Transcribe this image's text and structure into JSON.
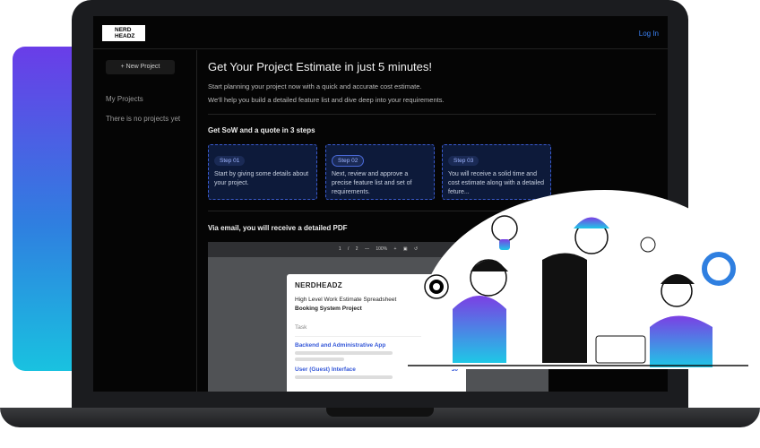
{
  "header": {
    "logo": "NERD HEADZ",
    "login": "Log In"
  },
  "sidebar": {
    "new_project": "+ New Project",
    "my_projects": "My Projects",
    "empty": "There is no projects yet"
  },
  "main": {
    "title": "Get Your Project Estimate in just 5 minutes!",
    "intro1": "Start planning your project now with a quick and accurate cost estimate.",
    "intro2": "We'll help you build a detailed feature list and dive deep into your requirements.",
    "steps_heading": "Get SoW and a quote in 3 steps",
    "steps": [
      {
        "label": "Step 01",
        "text": "Start by giving some details about your project."
      },
      {
        "label": "Step 02",
        "text": "Next, review and approve a precise feature list and set of requirements."
      },
      {
        "label": "Step 03",
        "text": "You will receive a solid time and cost estimate along with a detailed feture..."
      }
    ],
    "pdf_heading": "Via email, you will receive a detailed PDF"
  },
  "pdf": {
    "page": "1",
    "pages": "/ 2",
    "zoom": "100%",
    "logo": "NERDHEADZ",
    "doc_title": "High Level Work Estimate Spreadsheet",
    "project": "Booking System Project",
    "task_header": "Task",
    "items": [
      {
        "name": "Backend and Administrative App",
        "value": ""
      },
      {
        "name": "User (Guest) Interface",
        "value": "30"
      }
    ]
  }
}
